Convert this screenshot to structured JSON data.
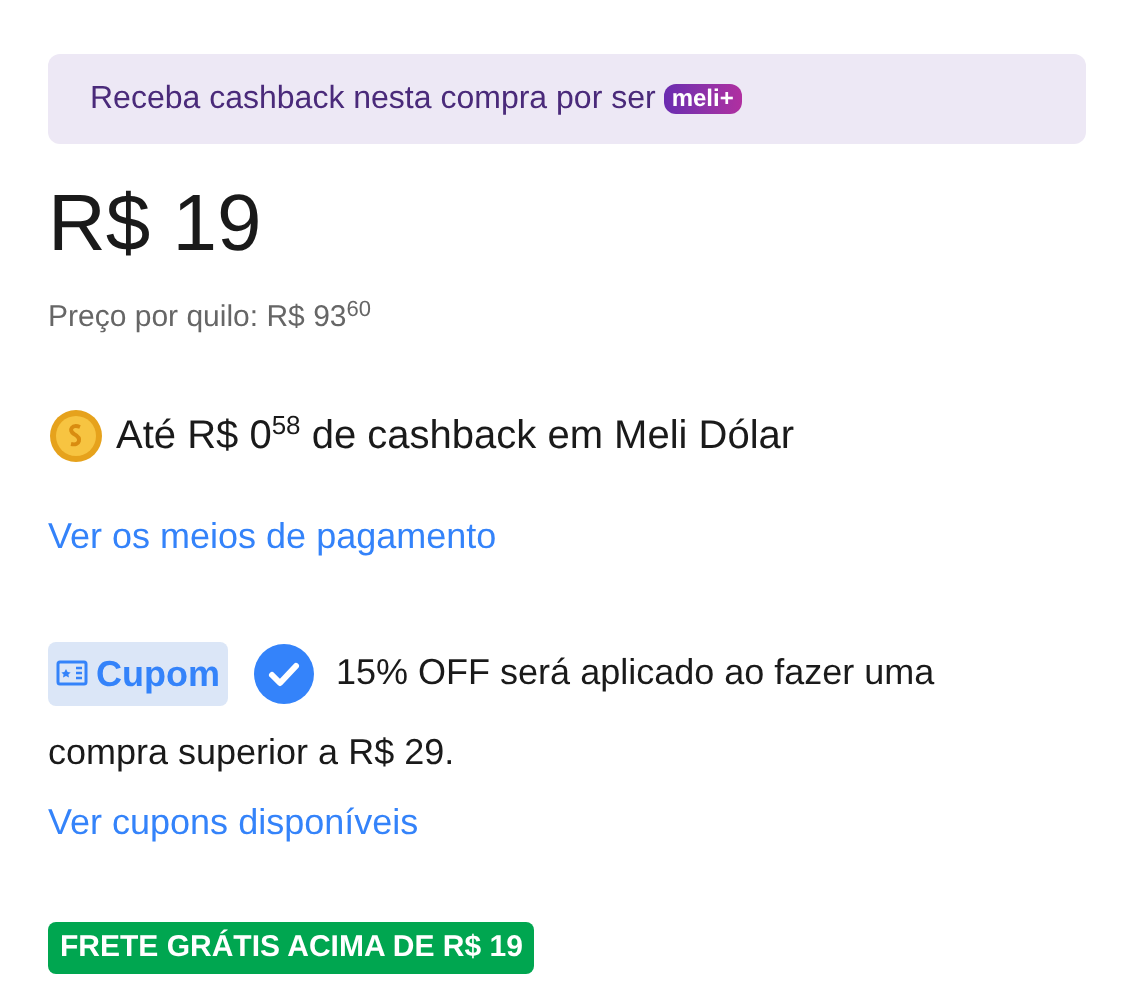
{
  "banner": {
    "text": "Receba cashback nesta compra por ser",
    "badge": "meli+"
  },
  "price": "R$ 19",
  "unit_price": "Preço por quilo: R$ 93$^{60}$",
  "cashback": "Até R$ 0$^{58}$ de cashback em Meli Dólar",
  "payment_link": "Ver os meios de pagamento",
  "coupon": {
    "label": "Cupom",
    "applied": true,
    "lines": [
      "15% OFF será aplicado ao fazer uma",
      "compra superior a R$ 29."
    ]
  },
  "coupons_link": "Ver cupons disponíveis",
  "shipping_badge": "FRETE GRÁTIS ACIMA DE R$ 19"
}
